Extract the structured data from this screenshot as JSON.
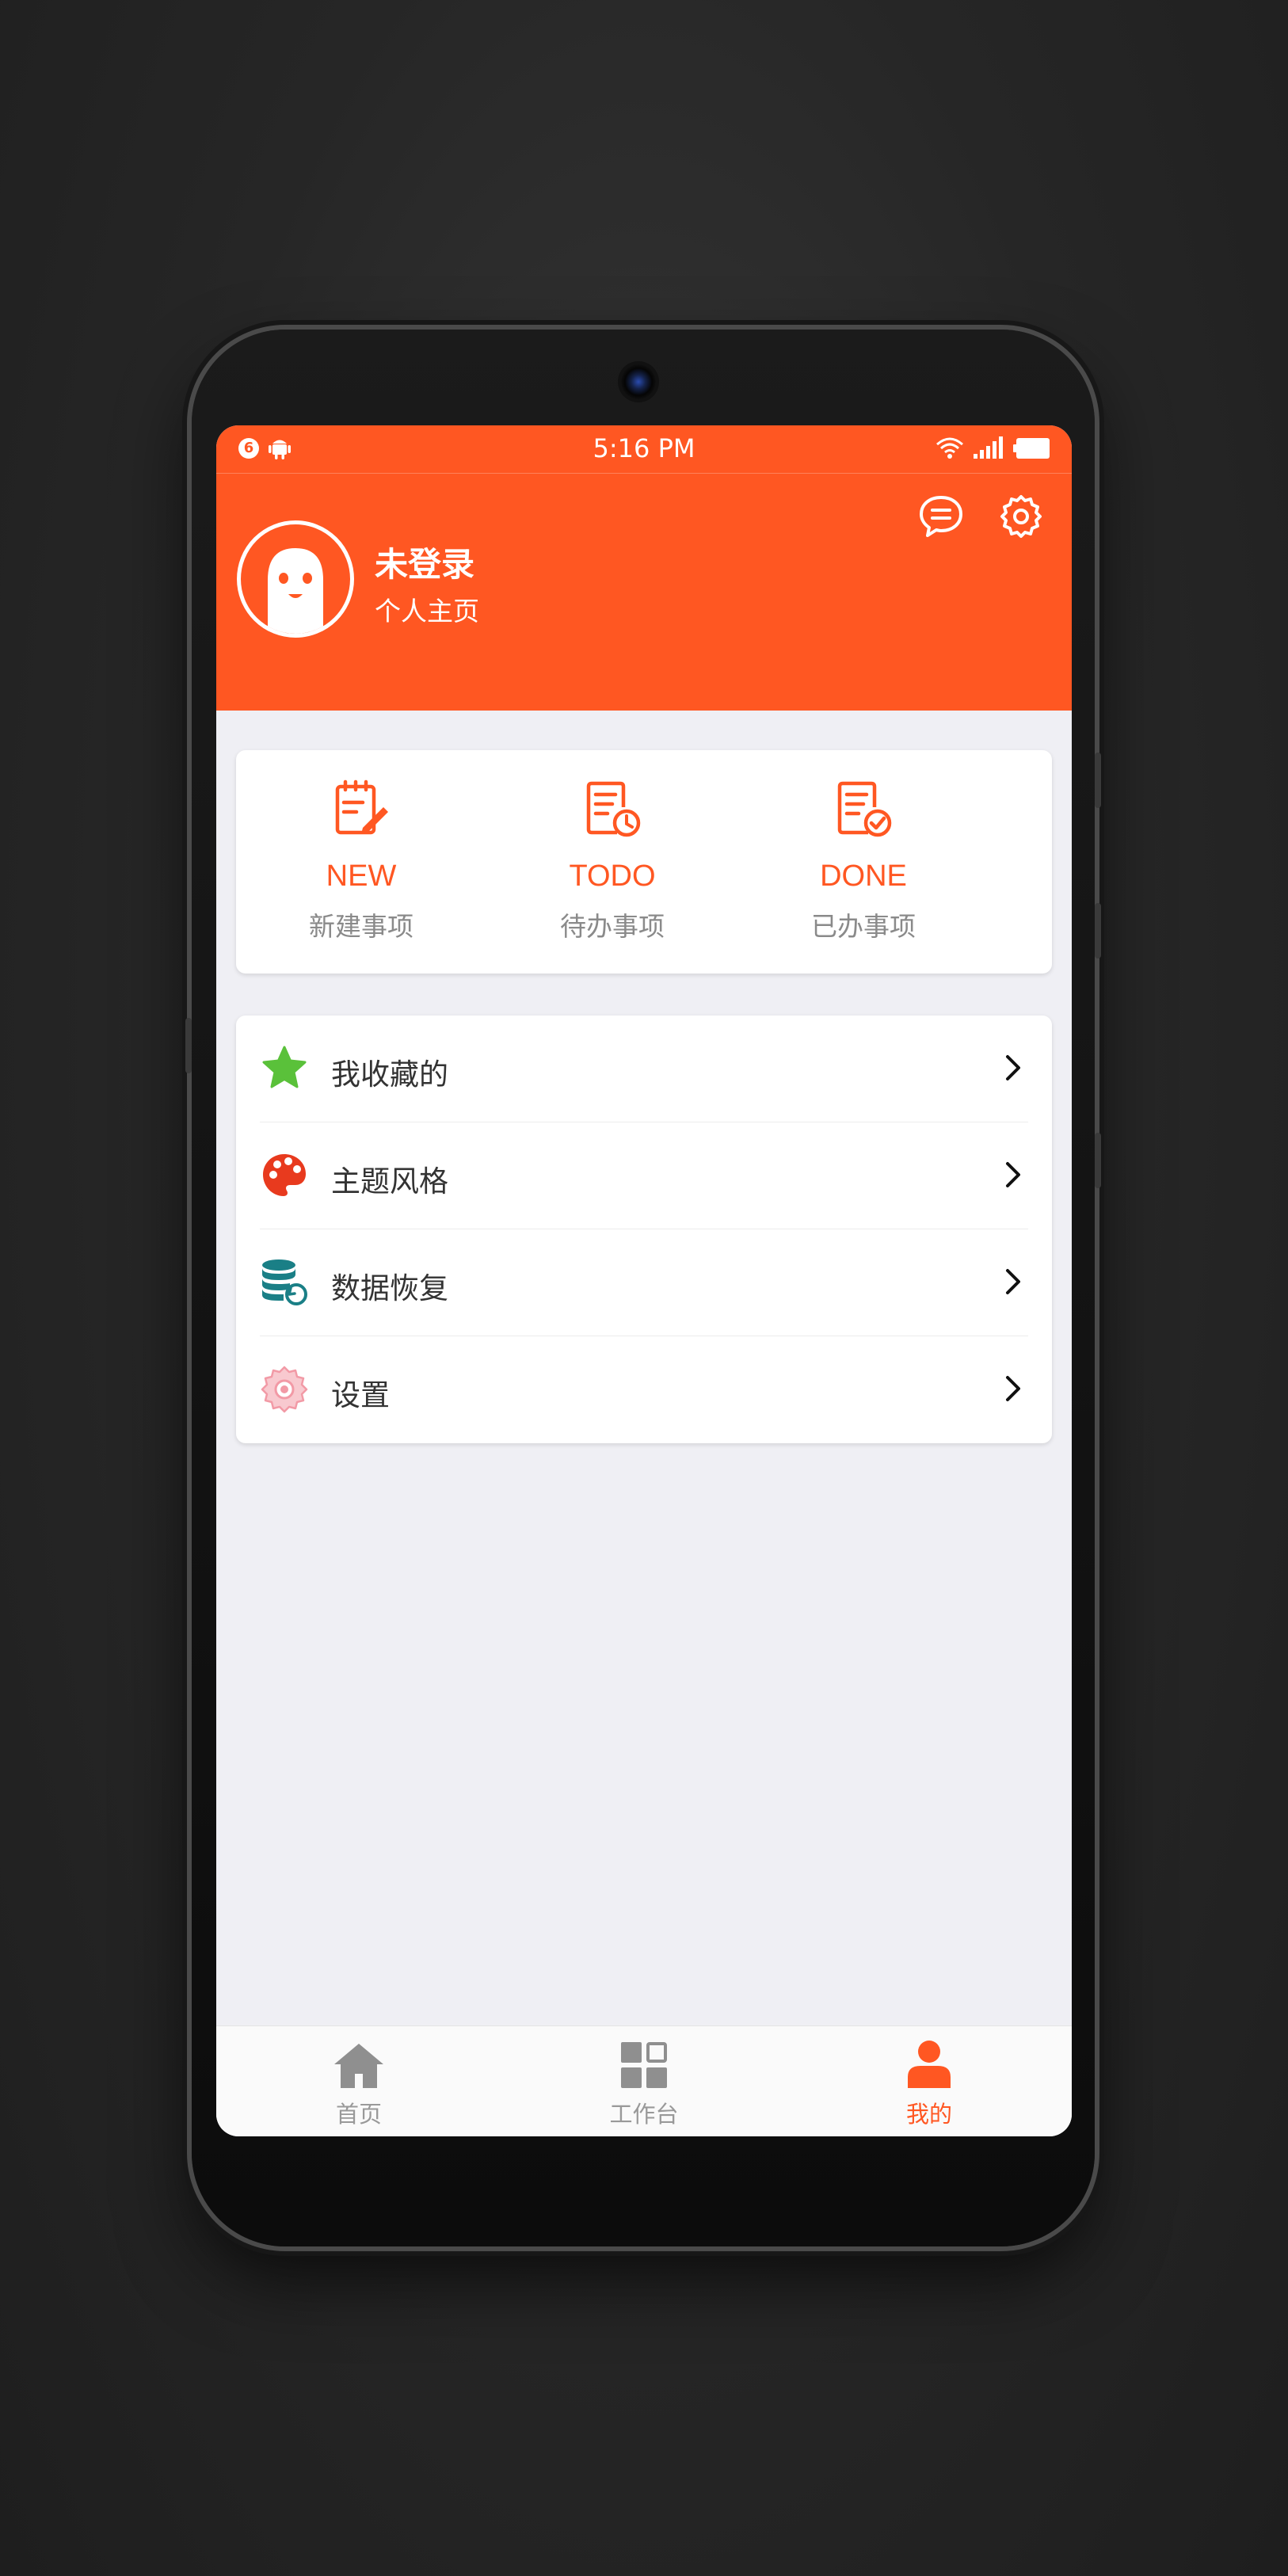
{
  "status_bar": {
    "notification_count": "6",
    "time": "5:16 PM",
    "icons": [
      "notification-badge",
      "android-icon",
      "wifi-icon",
      "signal-icon",
      "battery-icon"
    ]
  },
  "profile": {
    "name": "未登录",
    "subtitle": "个人主页",
    "actions": [
      "message-icon",
      "settings-icon"
    ]
  },
  "quick_actions": [
    {
      "title": "NEW",
      "subtitle": "新建事项",
      "icon": "new-note-icon"
    },
    {
      "title": "TODO",
      "subtitle": "待办事项",
      "icon": "todo-note-icon"
    },
    {
      "title": "DONE",
      "subtitle": "已办事项",
      "icon": "done-note-icon"
    }
  ],
  "menu": [
    {
      "label": "我收藏的",
      "icon": "star-icon"
    },
    {
      "label": "主题风格",
      "icon": "palette-icon"
    },
    {
      "label": "数据恢复",
      "icon": "database-restore-icon"
    },
    {
      "label": "设置",
      "icon": "gear-flower-icon"
    }
  ],
  "tabs": [
    {
      "label": "首页",
      "icon": "home-icon",
      "active": false
    },
    {
      "label": "工作台",
      "icon": "grid-icon",
      "active": false
    },
    {
      "label": "我的",
      "icon": "person-icon",
      "active": true
    }
  ],
  "colors": {
    "accent": "#ff5722",
    "background": "#efeff4",
    "star": "#5ac13a",
    "palette": "#e83a1e",
    "database": "#1a7f86",
    "gear": "#f29aa6"
  }
}
